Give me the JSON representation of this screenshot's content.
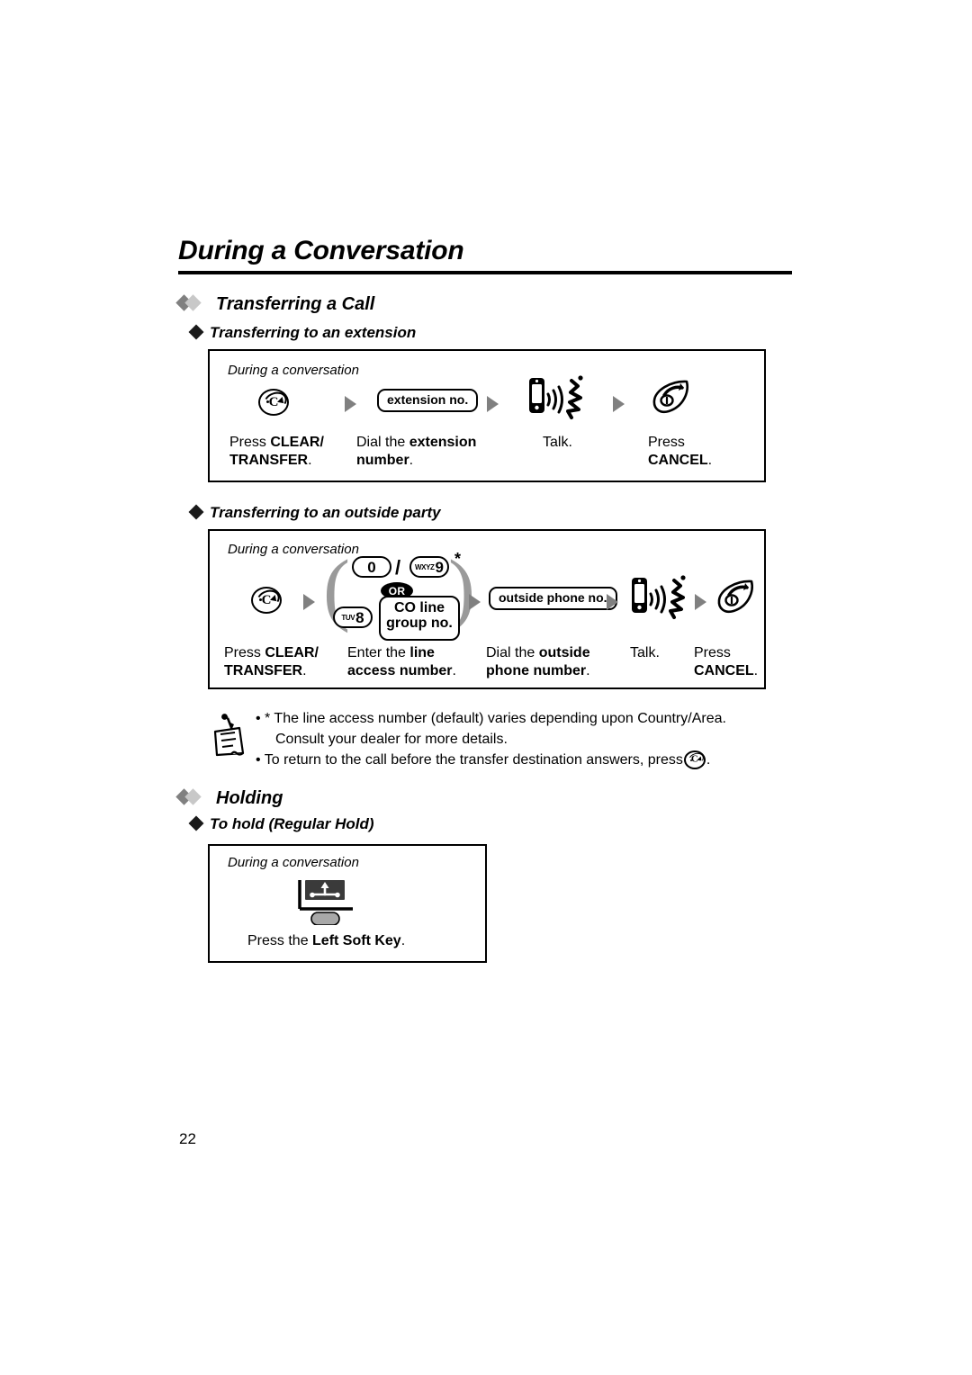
{
  "document": {
    "title": "During a Conversation",
    "page_number": "22"
  },
  "sections": [
    {
      "heading": "Transferring a Call",
      "subsections": [
        {
          "heading": "Transferring to an extension",
          "box": {
            "context_label": "During a conversation",
            "steps": [
              {
                "icon": "clear-transfer-key-icon",
                "caption_plain_1": "Press ",
                "caption_bold_1": "CLEAR/",
                "caption_bold_2": "TRANSFER",
                "caption_plain_2": "."
              },
              {
                "icon": "extension-number-field",
                "field_label": "extension no.",
                "caption_plain_1": "Dial the ",
                "caption_bold_1": "extension",
                "caption_bold_2": "number",
                "caption_plain_2": "."
              },
              {
                "icon": "talk-icon",
                "caption_plain_1": "Talk.",
                "caption_bold_1": "",
                "caption_bold_2": "",
                "caption_plain_2": ""
              },
              {
                "icon": "cancel-key-icon",
                "caption_plain_1": "Press",
                "caption_bold_1": "",
                "caption_bold_2": "CANCEL",
                "caption_plain_2": "."
              }
            ]
          }
        },
        {
          "heading": "Transferring to an outside party",
          "box": {
            "context_label": "During a conversation",
            "keys": {
              "zero": "0",
              "slash": "/",
              "nine_letters": "WXYZ",
              "nine_digit": "9",
              "star": "*",
              "or_label": "OR",
              "eight_letters": "TUV",
              "eight_digit": "8",
              "co_line_1": "CO line",
              "co_line_2": "group no."
            },
            "outside_field_label": "outside phone no.",
            "steps": [
              {
                "icon": "clear-transfer-key-icon",
                "caption_plain_1": "Press ",
                "caption_bold_1": "CLEAR/",
                "caption_bold_2": "TRANSFER",
                "caption_plain_2": "."
              },
              {
                "icon": "line-access-number-group",
                "caption_plain_1": "Enter the ",
                "caption_bold_1": "line",
                "caption_bold_2": "access number",
                "caption_plain_2": "."
              },
              {
                "icon": "outside-phone-number-field",
                "caption_plain_1": "Dial the ",
                "caption_bold_1": "outside",
                "caption_bold_2": "phone number",
                "caption_plain_2": "."
              },
              {
                "icon": "talk-icon",
                "caption_plain_1": "Talk.",
                "caption_bold_1": "",
                "caption_bold_2": "",
                "caption_plain_2": ""
              },
              {
                "icon": "cancel-key-icon",
                "caption_plain_1": "Press",
                "caption_bold_1": "",
                "caption_bold_2": "CANCEL",
                "caption_plain_2": "."
              }
            ]
          }
        }
      ],
      "notes": {
        "icon": "note-memo-icon",
        "items": [
          "• * The line access number (default) varies depending upon Country/Area.",
          "Consult your dealer for more details.",
          "• To return to the call before the transfer destination answers, press"
        ],
        "trailing_period": "."
      }
    },
    {
      "heading": "Holding",
      "subsections": [
        {
          "heading": "To hold (Regular Hold)",
          "box": {
            "context_label": "During a conversation",
            "steps": [
              {
                "icon": "left-soft-key-icon",
                "caption_plain_1": "Press the ",
                "caption_bold_1": "Left Soft Key",
                "caption_plain_2": "."
              }
            ]
          }
        }
      ]
    }
  ],
  "colors": {
    "accent_dark_diamond": "#808080",
    "accent_light_diamond": "#c8c8c8",
    "arrow": "#808080",
    "rule": "#000000",
    "softkey_fill": "#a8a8a8",
    "softkey_display": "#3a3a3a"
  }
}
